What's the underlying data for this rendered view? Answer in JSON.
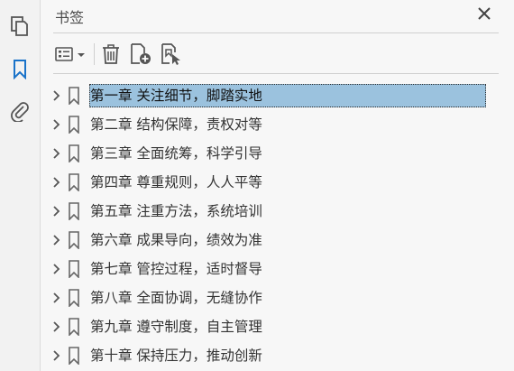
{
  "panel": {
    "title": "书签"
  },
  "sidebar": {
    "items": [
      {
        "name": "pages-icon"
      },
      {
        "name": "bookmark-icon"
      },
      {
        "name": "attachment-icon"
      }
    ]
  },
  "toolbar": {
    "buttons": [
      "options-menu-button",
      "delete-bookmark-button",
      "new-bookmark-button",
      "new-bookmark-from-structure-button"
    ]
  },
  "bookmarks": [
    {
      "label": "第一章  关注细节，脚踏实地",
      "selected": true
    },
    {
      "label": "第二章  结构保障，责权对等",
      "selected": false
    },
    {
      "label": "第三章  全面统筹，科学引导",
      "selected": false
    },
    {
      "label": "第四章  尊重规则，人人平等",
      "selected": false
    },
    {
      "label": "第五章  注重方法，系统培训",
      "selected": false
    },
    {
      "label": "第六章  成果导向，绩效为准",
      "selected": false
    },
    {
      "label": "第七章  管控过程，适时督导",
      "selected": false
    },
    {
      "label": "第八章  全面协调，无缝协作",
      "selected": false
    },
    {
      "label": "第九章  遵守制度，自主管理",
      "selected": false
    },
    {
      "label": "第十章  保持压力，推动创新",
      "selected": false
    }
  ],
  "colors": {
    "accent": "#1a73c9",
    "selection": "#9bc2de"
  }
}
